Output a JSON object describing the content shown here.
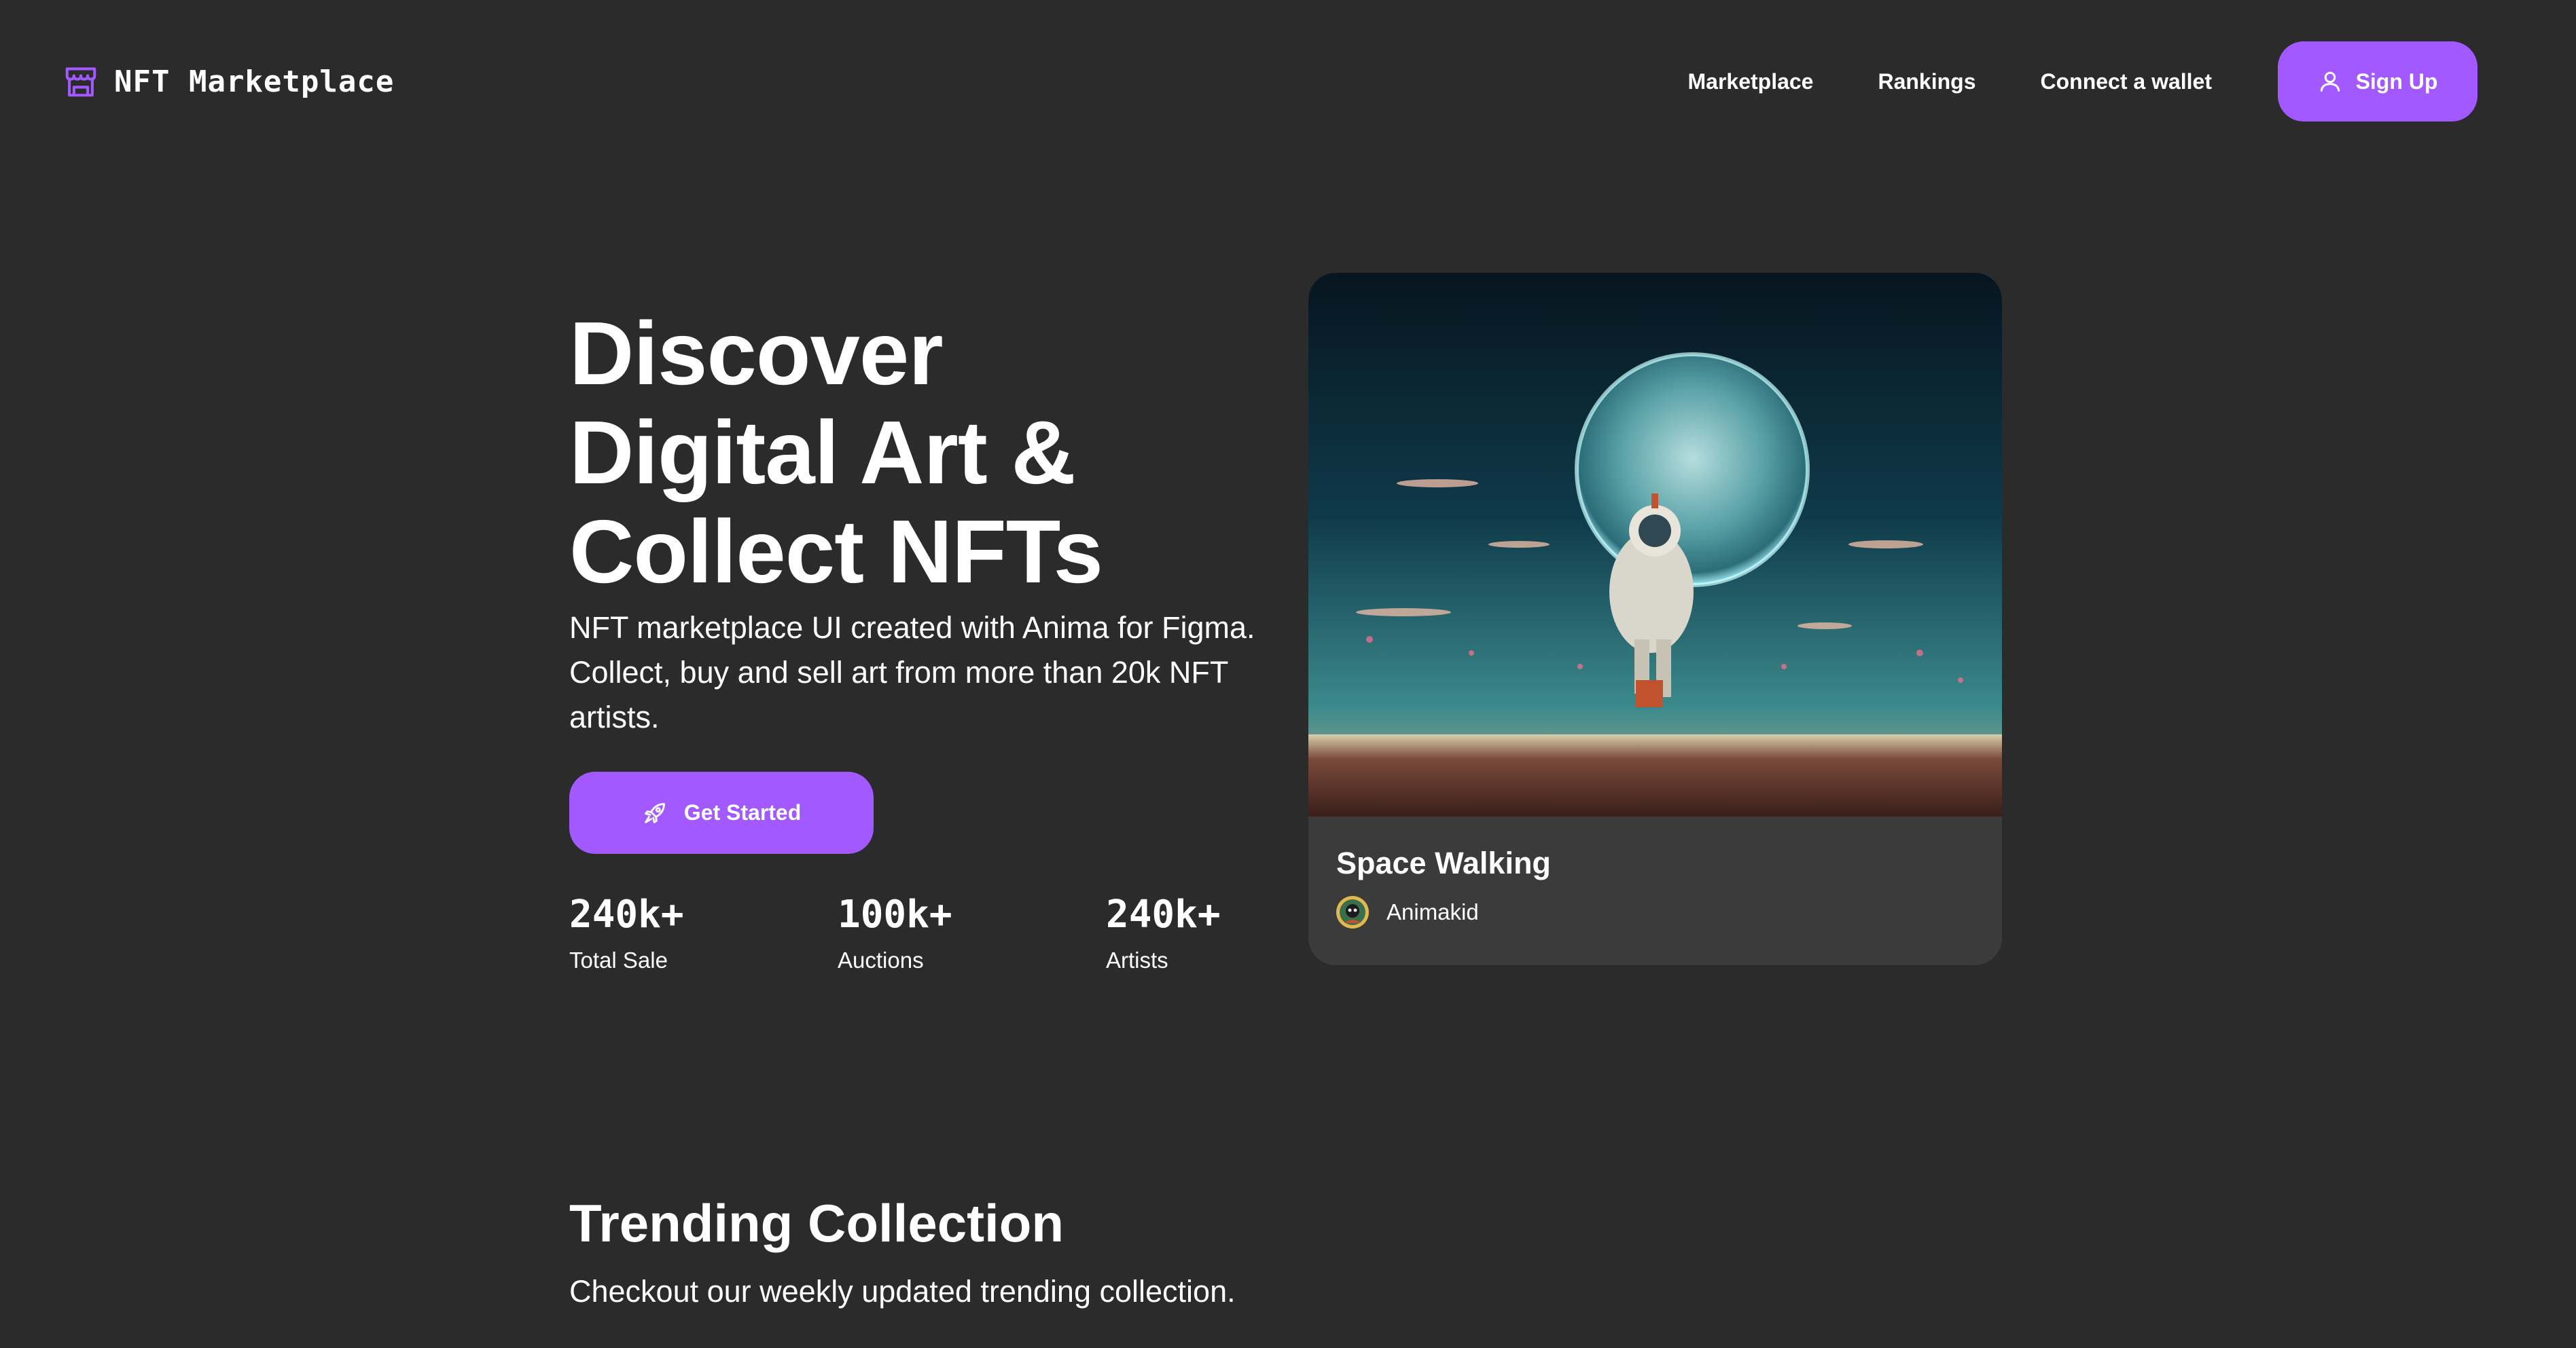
{
  "brand": {
    "name": "NFT Marketplace",
    "icon": "storefront-icon"
  },
  "nav": {
    "links": [
      "Marketplace",
      "Rankings",
      "Connect a wallet"
    ],
    "signup_label": "Sign Up",
    "signup_icon": "user-icon"
  },
  "hero": {
    "title_lines": [
      "Discover",
      "Digital Art &",
      "Collect NFTs"
    ],
    "subtitle": "NFT marketplace UI created with Anima for Figma. Collect, buy and sell art from more than 20k NFT artists.",
    "cta_label": "Get Started",
    "cta_icon": "rocket-icon",
    "stats": [
      {
        "value": "240k+",
        "label": "Total Sale"
      },
      {
        "value": "100k+",
        "label": "Auctions"
      },
      {
        "value": "240k+",
        "label": "Artists"
      }
    ]
  },
  "featured": {
    "title": "Space Walking",
    "artist": "Animakid",
    "image": "astronaut-planet-artwork"
  },
  "trending": {
    "title": "Trending Collection",
    "subtitle": "Checkout our weekly updated trending collection."
  },
  "colors": {
    "background": "#2b2b2b",
    "card": "#3b3b3b",
    "accent": "#a259ff",
    "text": "#ffffff"
  }
}
